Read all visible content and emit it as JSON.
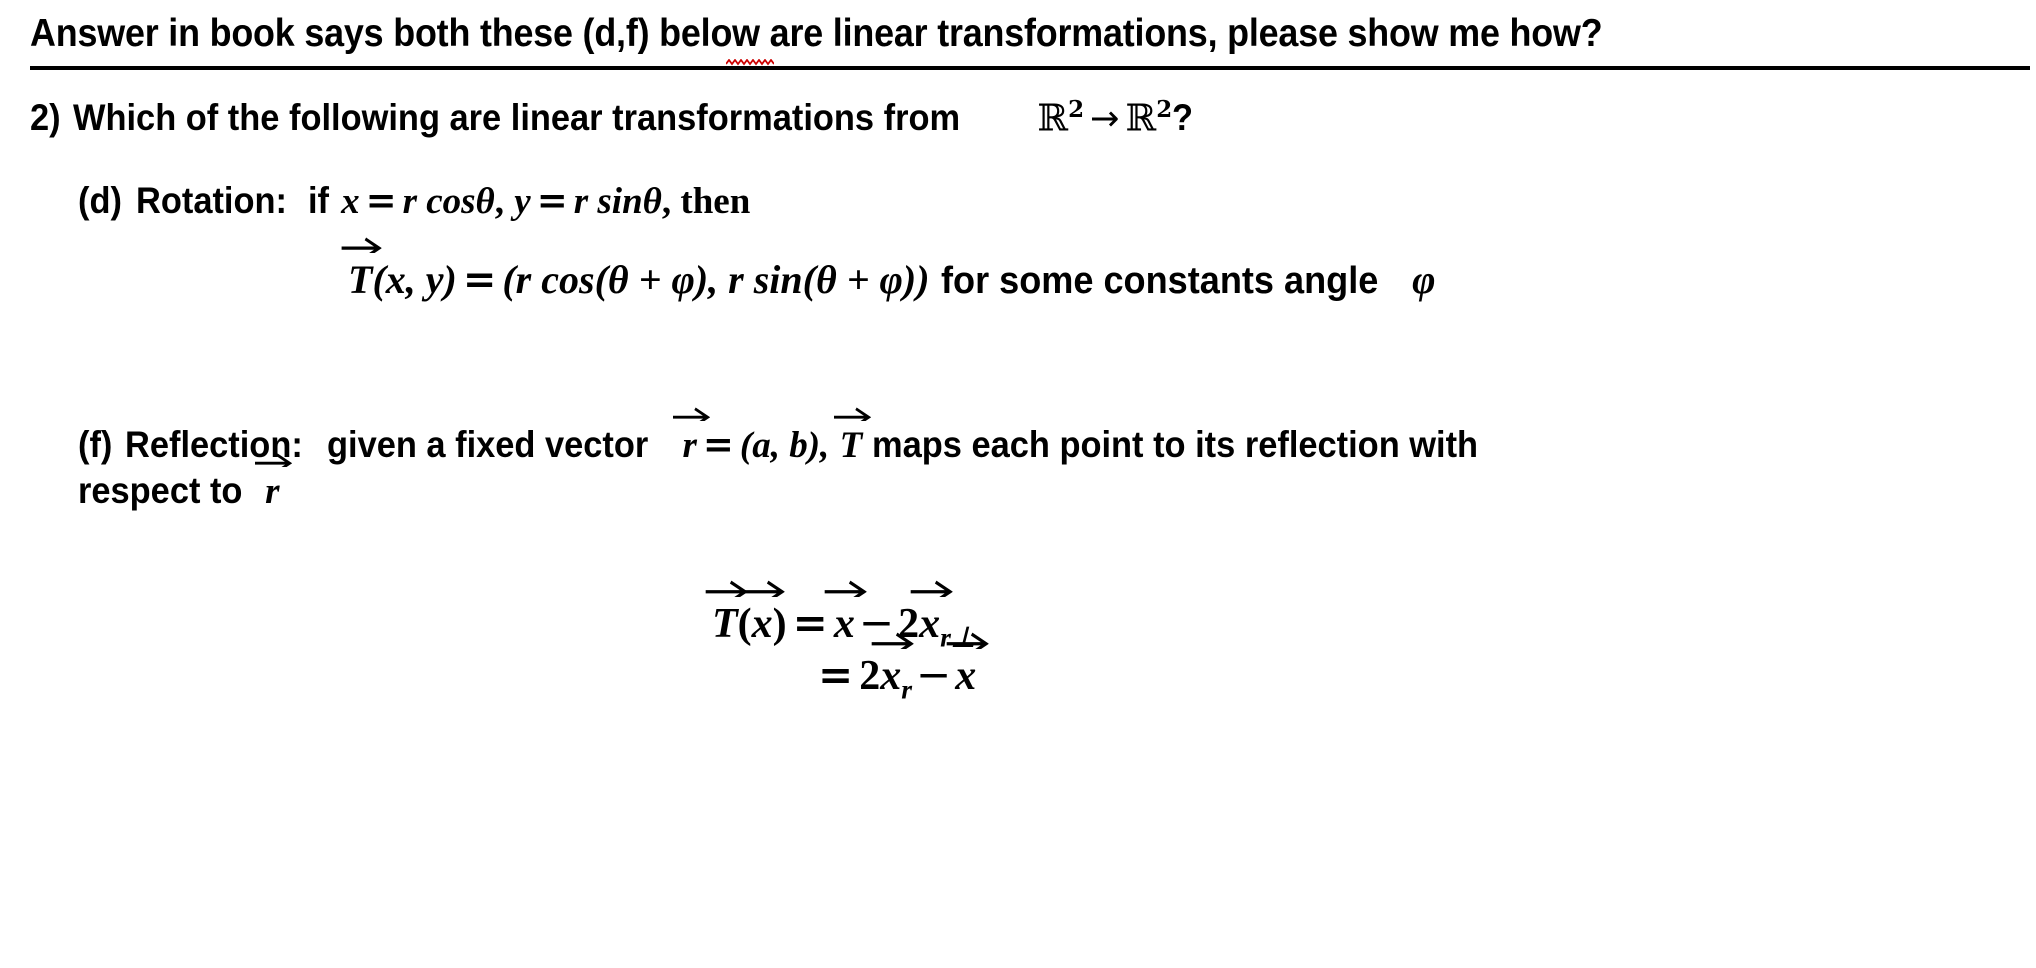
{
  "document": {
    "title_question": "Answer in book says both these (d,f) below are linear transformations, please show me how?",
    "spellcheck_word": "d,f",
    "colors": {
      "text": "#000000",
      "spellcheck_underline": "#cc0000",
      "background": "#ffffff"
    },
    "question": {
      "number": "2)",
      "prompt_before": "Which of the following are linear transformations from",
      "domain": "ℝ",
      "domain_exponent": "2",
      "arrow": "→",
      "codomain": "ℝ",
      "codomain_exponent": "2",
      "prompt_after": "?"
    },
    "parts": [
      {
        "label": "(d)",
        "name": "Rotation:",
        "lead_in": "if",
        "condition_x_lhs": "x",
        "condition_x_rhs": "r cosθ",
        "condition_sep": ",",
        "condition_y_lhs": "y",
        "condition_y_rhs": "r sinθ",
        "tail": ", then",
        "equation": {
          "lhs_func": "T",
          "lhs_args": "(x, y)",
          "eq": "=",
          "rhs": "(r cos(θ + φ), r sin(θ + φ))",
          "trailing_text": "for some constants angle",
          "trailing_symbol": "φ"
        }
      },
      {
        "label": "(f)",
        "name": "Reflection:",
        "text_1": "given a fixed vector",
        "vector_r": "r",
        "eq_1": "=",
        "components": "(a, b),",
        "vector_T": "T",
        "text_2": "maps each point to its reflection with",
        "text_3": "respect to",
        "vector_r_2": "r",
        "equations": [
          {
            "lhs": "T(x)",
            "eq": "=",
            "rhs": "x − 2x",
            "rhs_subscript": "r⊥"
          },
          {
            "lhs": "",
            "eq": "=",
            "rhs": "2x",
            "rhs_subscript": "r",
            "rhs_tail": "− x"
          }
        ]
      }
    ]
  }
}
